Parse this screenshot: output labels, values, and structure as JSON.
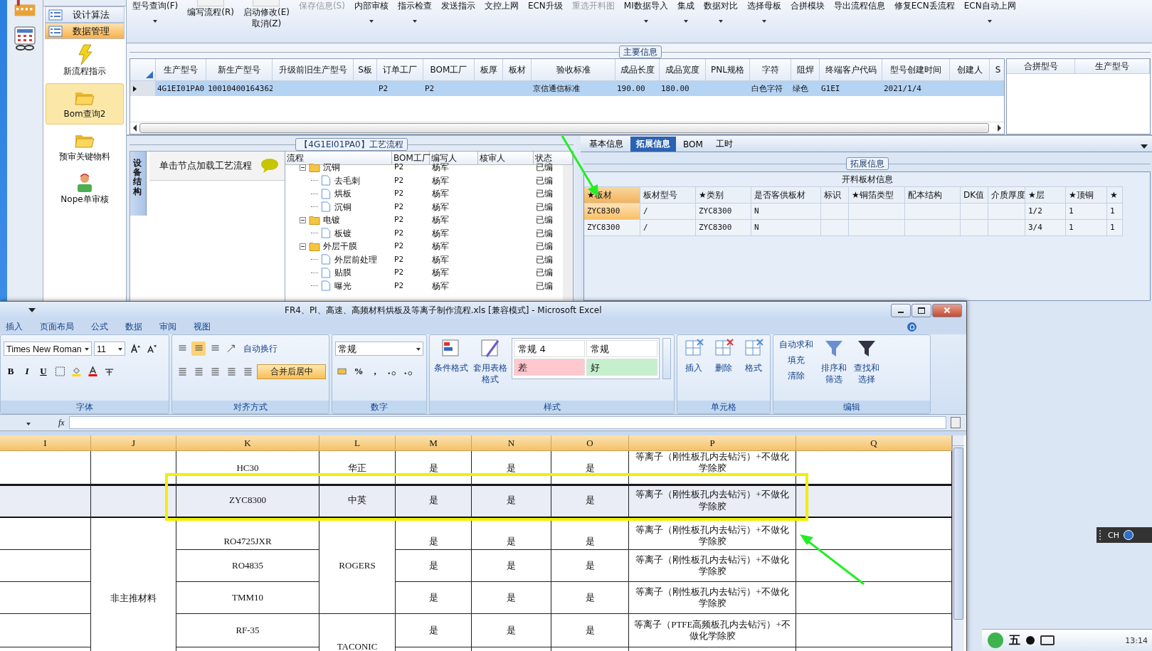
{
  "nav": {
    "items": [
      {
        "label": "设计算法",
        "selected": false
      },
      {
        "label": "数据管理",
        "selected": true
      }
    ],
    "tiles": [
      {
        "label": "新流程指示",
        "kind": "bolt",
        "selected": false
      },
      {
        "label": "Bom查询2",
        "kind": "folder",
        "selected": true
      },
      {
        "label": "预审关键物料",
        "kind": "folder",
        "selected": false
      },
      {
        "label": "Nope单审核",
        "kind": "person",
        "selected": false
      }
    ]
  },
  "toolbar": [
    {
      "label": "型号查询(F)",
      "dropdown": true,
      "disabled": false
    },
    {
      "label": "编写流程(R)",
      "kind": "big",
      "disabled": false
    },
    {
      "label": "启动修改(E)",
      "sub": "取消(Z)",
      "kind": "big",
      "disabled": false
    },
    {
      "label": "保存信息(S)",
      "disabled": true
    },
    {
      "label": "内部审核",
      "dropdown": true,
      "disabled": false
    },
    {
      "label": "指示检查",
      "dropdown": true,
      "disabled": false
    },
    {
      "label": "发送指示",
      "disabled": false
    },
    {
      "label": "文控上网",
      "disabled": false
    },
    {
      "label": "ECN升级",
      "disabled": false
    },
    {
      "label": "重选开料图",
      "disabled": true
    },
    {
      "label": "MI数据导入",
      "dropdown": true,
      "disabled": false
    },
    {
      "label": "集成",
      "dropdown": true,
      "disabled": false
    },
    {
      "label": "数据对比",
      "dropdown": true,
      "disabled": false
    },
    {
      "label": "选择母板",
      "dropdown": true,
      "disabled": false
    },
    {
      "label": "合拼模块",
      "disabled": false
    },
    {
      "label": "导出流程信息",
      "disabled": false
    },
    {
      "label": "修复ECN丢流程",
      "disabled": false
    },
    {
      "label": "ECN自动上网",
      "dropdown": true,
      "disabled": false
    }
  ],
  "main_info": {
    "title": "主要信息",
    "columns": [
      "生产型号",
      "新生产型号",
      "升级前旧生产型号",
      "S板",
      "订单工厂",
      "BOM工厂",
      "板厚",
      "板材",
      "验收标准",
      "成品长度",
      "成品宽度",
      "PNL规格",
      "字符",
      "阻焊",
      "终端客户代码",
      "型号创建时间",
      "创建人",
      "S"
    ],
    "rows": [
      {
        "selected": true,
        "cells": [
          "4G1EI01PA0",
          "10010400164362",
          "",
          "",
          "P2",
          "P2",
          "",
          "",
          "京信通信标准",
          "190.00",
          "180.00",
          "",
          "白色字符",
          "绿色",
          "G1EI",
          "2021/1/4",
          "",
          ""
        ]
      }
    ],
    "merge_columns": [
      "合拼型号",
      "生产型号"
    ]
  },
  "process": {
    "title": "【4G1EI01PA0】工艺流程",
    "side_tab": "设备结构",
    "hint": "单击节点加载工艺流程",
    "columns": [
      "流程",
      "BOM工厂",
      "编写人",
      "核审人",
      "状态"
    ],
    "tree": [
      {
        "name": "沉铜",
        "kind": "folder",
        "bom": "P2",
        "writer": "杨军",
        "status": "已编",
        "expanded": true,
        "children": [
          {
            "name": "去毛刺",
            "kind": "file",
            "bom": "P2",
            "writer": "杨军",
            "status": "已编"
          },
          {
            "name": "烘板",
            "kind": "file",
            "bom": "P2",
            "writer": "杨军",
            "status": "已编"
          },
          {
            "name": "沉铜",
            "kind": "file",
            "bom": "P2",
            "writer": "杨军",
            "status": "已编"
          }
        ]
      },
      {
        "name": "电镀",
        "kind": "folder",
        "bom": "P2",
        "writer": "杨军",
        "status": "已编",
        "expanded": true,
        "children": [
          {
            "name": "板镀",
            "kind": "file",
            "bom": "P2",
            "writer": "杨军",
            "status": "已编"
          }
        ]
      },
      {
        "name": "外层干膜",
        "kind": "folder",
        "bom": "P2",
        "writer": "杨军",
        "status": "已编",
        "expanded": true,
        "children": [
          {
            "name": "外层前处理",
            "kind": "file",
            "bom": "P2",
            "writer": "杨军",
            "status": "已编"
          },
          {
            "name": "贴膜",
            "kind": "file",
            "bom": "P2",
            "writer": "杨军",
            "status": "已编"
          },
          {
            "name": "曝光",
            "kind": "file",
            "bom": "P2",
            "writer": "杨军",
            "status": "已编"
          }
        ]
      }
    ]
  },
  "detail": {
    "tabs": [
      {
        "label": "基本信息",
        "selected": false
      },
      {
        "label": "拓展信息",
        "selected": true
      },
      {
        "label": "BOM",
        "selected": false
      },
      {
        "label": "工时",
        "selected": false
      }
    ],
    "section_title": "拓展信息",
    "table_title": "开料板材信息",
    "columns": [
      "★板材",
      "板材型号",
      "★类别",
      "是否客供板材",
      "标识",
      "★铜箔类型",
      "配本结构",
      "DK值",
      "介质厚度",
      "★层",
      "★顶铜",
      "★"
    ],
    "rows": [
      {
        "cells": [
          "ZYC8300",
          "/",
          "ZYC8300",
          "N",
          "",
          "",
          "",
          "",
          "",
          "1/2",
          "1",
          "1"
        ],
        "selected": true
      },
      {
        "cells": [
          "ZYC8300",
          "/",
          "ZYC8300",
          "N",
          "",
          "",
          "",
          "",
          "",
          "3/4",
          "1",
          "1"
        ],
        "selected": false
      }
    ]
  },
  "excel": {
    "title": "FR4、PI、高速、高频材料烘板及等离子制作流程.xls  [兼容模式] - Microsoft Excel",
    "tabs": [
      "插入",
      "页面布局",
      "公式",
      "数据",
      "审阅",
      "视图"
    ],
    "font": "Times New Roman",
    "font_size": "11",
    "font_buttons": [
      "B",
      "I",
      "U"
    ],
    "wrap_text": "自动换行",
    "merge_center": {
      "label": "合并后居中",
      "on": true
    },
    "number_format": "常规",
    "number_buttons": [
      "%",
      ","
    ],
    "styles": [
      {
        "label": "常规 4",
        "color": "#ffffff"
      },
      {
        "label": "常规",
        "color": "#ffffff"
      },
      {
        "label": "差",
        "color": "#ffc7ce"
      },
      {
        "label": "好",
        "color": "#c6efce"
      }
    ],
    "conditional": "条件格式",
    "table_format": "套用表格格式",
    "cells_buttons": [
      "插入",
      "删除",
      "格式"
    ],
    "edit_small": [
      "自动求和",
      "填充",
      "清除"
    ],
    "edit_big": [
      "排序和筛选",
      "查找和选择"
    ],
    "groups": [
      "字体",
      "对齐方式",
      "数字",
      "样式",
      "单元格",
      "编辑"
    ],
    "fx": "fx",
    "columns": [
      "I",
      "J",
      "K",
      "L",
      "M",
      "N",
      "O",
      "P",
      "Q"
    ],
    "rows": [
      {
        "highlighted": false,
        "cells": [
          {},
          {},
          {
            "text": "HC30"
          },
          {
            "text": "华正"
          },
          {
            "text": "是"
          },
          {
            "text": "是"
          },
          {
            "text": "是"
          },
          {
            "text": "等离子（刚性板孔内去钻污）+不做化学除胶"
          },
          {}
        ]
      },
      {
        "highlighted": true,
        "cells": [
          {},
          {},
          {
            "text": "ZYC8300"
          },
          {
            "text": "中英"
          },
          {
            "text": "是"
          },
          {
            "text": "是"
          },
          {
            "text": "是"
          },
          {
            "text": "等离子（刚性板孔内去钻污）+不做化学除胶"
          },
          {}
        ]
      },
      {
        "highlighted": false,
        "cells": [
          {},
          {
            "text": "非主推材料",
            "rowspan": 5
          },
          {
            "text": "RO4725JXR"
          },
          {
            "text": "ROGERS",
            "rowspan": 3
          },
          {
            "text": "是"
          },
          {
            "text": "是"
          },
          {
            "text": "是"
          },
          {
            "text": "等离子（刚性板孔内去钻污）+不做化学除胶"
          },
          {}
        ]
      },
      {
        "highlighted": false,
        "cells": [
          {},
          {
            "text": "RO4835"
          },
          {
            "text": "是"
          },
          {
            "text": "是"
          },
          {
            "text": "是"
          },
          {
            "text": "等离子（刚性板孔内去钻污）+不做化学除胶"
          },
          {}
        ]
      },
      {
        "highlighted": false,
        "cells": [
          {},
          {
            "text": "TMM10"
          },
          {
            "text": "是"
          },
          {
            "text": "是"
          },
          {
            "text": "是"
          },
          {
            "text": "等离子（刚性板孔内去钻污）+不做化学除胶"
          },
          {}
        ]
      },
      {
        "highlighted": false,
        "cells": [
          {},
          {
            "text": "RF-35"
          },
          {
            "text": "TACONIC",
            "rowspan": 2
          },
          {
            "text": "是"
          },
          {
            "text": "是"
          },
          {
            "text": "是"
          },
          {
            "text": "等离子（PTFE高频板孔内去钻污）+不做化学除胶"
          },
          {}
        ]
      },
      {
        "highlighted": false,
        "cells": [
          {},
          {},
          {},
          {},
          {},
          {},
          {}
        ]
      }
    ]
  },
  "language_bar": "CH",
  "ime": "五",
  "clock": "13:14"
}
